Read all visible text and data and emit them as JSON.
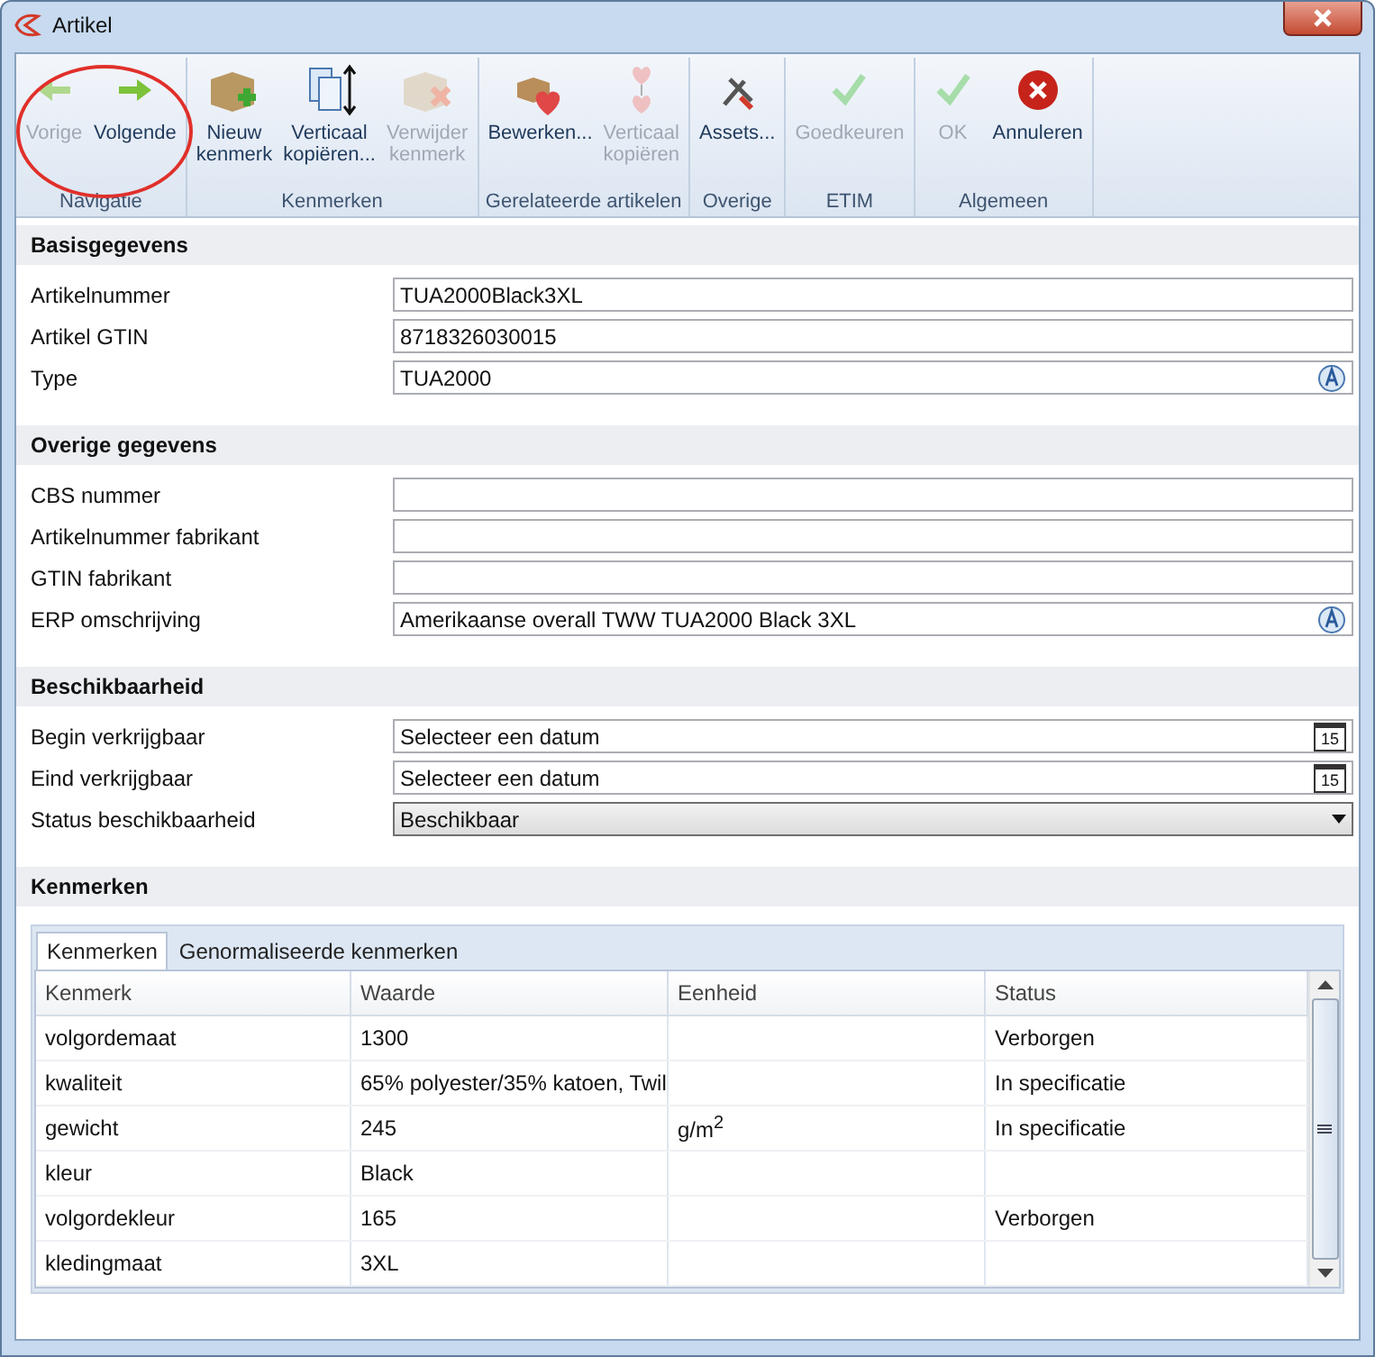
{
  "window": {
    "title": "Artikel"
  },
  "toolbar": {
    "groups": [
      {
        "label": "Navigatie",
        "circled": true,
        "buttons": [
          {
            "label": "Vorige",
            "disabled": true
          },
          {
            "label": "Volgende",
            "disabled": false
          }
        ]
      },
      {
        "label": "Kenmerken",
        "circled": false,
        "buttons": [
          {
            "label": "Nieuw\nkenmerk",
            "disabled": false
          },
          {
            "label": "Verticaal\nkopiëren...",
            "disabled": false
          },
          {
            "label": "Verwijder\nkenmerk",
            "disabled": true
          }
        ]
      },
      {
        "label": "Gerelateerde artikelen",
        "circled": false,
        "buttons": [
          {
            "label": "Bewerken...",
            "disabled": false
          },
          {
            "label": "Verticaal\nkopiëren",
            "disabled": true
          }
        ]
      },
      {
        "label": "Overige",
        "circled": false,
        "buttons": [
          {
            "label": "Assets...",
            "disabled": false
          }
        ]
      },
      {
        "label": "ETIM",
        "circled": false,
        "buttons": [
          {
            "label": "Goedkeuren",
            "disabled": true
          }
        ]
      },
      {
        "label": "Algemeen",
        "circled": false,
        "buttons": [
          {
            "label": "OK",
            "disabled": true
          },
          {
            "label": "Annuleren",
            "disabled": false
          }
        ]
      }
    ]
  },
  "sections": [
    {
      "title": "Basisgegevens",
      "fields": [
        {
          "label": "Artikelnummer",
          "kind": "text",
          "value": "TUA2000Black3XL",
          "lookup": false
        },
        {
          "label": "Artikel GTIN",
          "kind": "text",
          "value": "8718326030015",
          "lookup": false
        },
        {
          "label": "Type",
          "kind": "text",
          "value": "TUA2000",
          "lookup": true
        }
      ]
    },
    {
      "title": "Overige gegevens",
      "fields": [
        {
          "label": "CBS nummer",
          "kind": "text",
          "lookup": false
        },
        {
          "label": "Artikelnummer fabrikant",
          "kind": "text",
          "lookup": false
        },
        {
          "label": "GTIN fabrikant",
          "kind": "text",
          "lookup": false
        },
        {
          "label": "ERP omschrijving",
          "kind": "text",
          "value": "Amerikaanse overall TWW TUA2000 Black 3XL",
          "lookup": true
        }
      ]
    },
    {
      "title": "Beschikbaarheid",
      "fields": [
        {
          "label": "Begin verkrijgbaar",
          "kind": "date",
          "placeholder": "Selecteer een datum",
          "calendar_day": "15"
        },
        {
          "label": "Eind verkrijgbaar",
          "kind": "date",
          "placeholder": "Selecteer een datum",
          "calendar_day": "15"
        },
        {
          "label": "Status beschikbaarheid",
          "kind": "select",
          "value": "Beschikbaar"
        }
      ]
    }
  ],
  "kenmerken": {
    "title": "Kenmerken",
    "tabs": [
      {
        "label": "Kenmerken",
        "selected": true
      },
      {
        "label": "Genormaliseerde kenmerken",
        "selected": false
      }
    ],
    "table": {
      "columns": [
        "Kenmerk",
        "Waarde",
        "Eenheid",
        "Status"
      ],
      "rows": [
        [
          "volgordemaat",
          "1300",
          "",
          "Verborgen"
        ],
        [
          "kwaliteit",
          "65% polyester/35% katoen, Twil",
          "",
          "In specificatie"
        ],
        [
          "gewicht",
          "245",
          "g/m$^{2}$",
          "In specificatie"
        ],
        [
          "kleur",
          "Black",
          "",
          ""
        ],
        [
          "volgordekleur",
          "165",
          "",
          "Verborgen"
        ],
        [
          "kledingmaat",
          "3XL",
          "",
          ""
        ]
      ]
    }
  }
}
